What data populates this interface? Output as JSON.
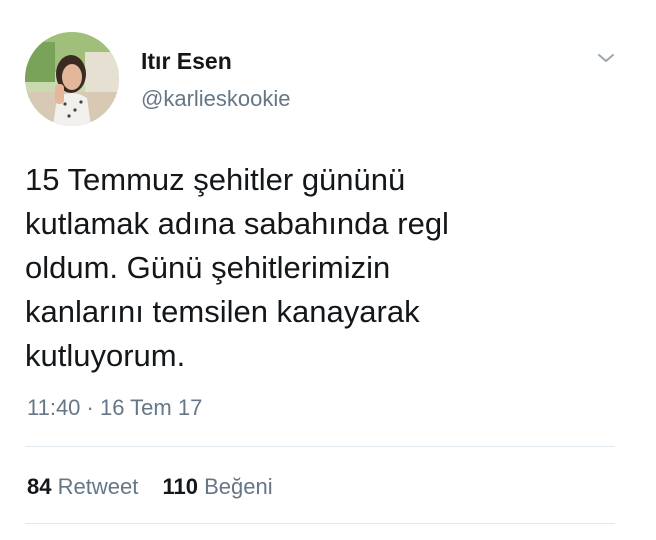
{
  "author": {
    "name": "Itır Esen",
    "handle": "@karlieskookie"
  },
  "tweet": {
    "lines": [
      "15 Temmuz şehitler gününü",
      "kutlamak adına sabahında regl",
      "oldum. Günü şehitlerimizin",
      "kanlarını temsilen kanayarak",
      "kutluyorum."
    ],
    "timestamp": "11:40 · 16 Tem 17"
  },
  "stats": {
    "retweet_count": "84",
    "retweet_label": "Retweet",
    "like_count": "110",
    "like_label": "Beğeni"
  },
  "icons": {
    "menu": "chevron-down-icon"
  },
  "colors": {
    "text": "#14171a",
    "secondary": "#657786",
    "divider": "#e1e8ed"
  }
}
